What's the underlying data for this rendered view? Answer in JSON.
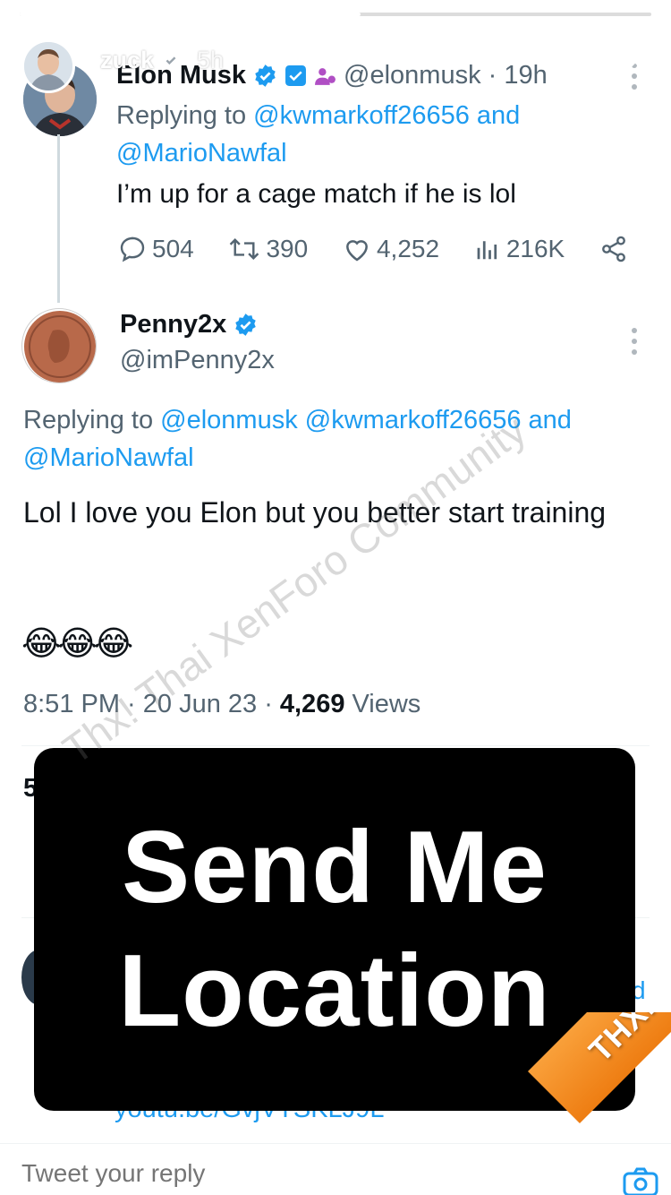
{
  "story": {
    "username": "zuck",
    "time": "5h",
    "progress": 0.54
  },
  "tweet1": {
    "name": "Elon Musk",
    "handle_time": "@elonmusk · 19h",
    "replying_prefix": "Replying to",
    "replying_handle1": "@kwmarkoff26656",
    "replying_and": "and",
    "replying_handle2": "@MarioNawfal",
    "text": "I’m up for a cage match if he is lol",
    "replies": "504",
    "retweets": "390",
    "likes": "4,252",
    "views": "216K"
  },
  "tweet2": {
    "name": "Penny2x",
    "handle": "@imPenny2x",
    "replying_prefix": "Replying to",
    "replying_handle1": "@elonmusk",
    "replying_handle2": "@kwmarkoff26656",
    "replying_and": "and",
    "replying_handle3": "@MarioNawfal",
    "text": "Lol I love you Elon but you better start training",
    "emoji": "😂😂😂",
    "time_date": "8:51 PM · 20 Jun 23 ·",
    "views_count": "4,269",
    "views_label": "Views"
  },
  "hidden_fragments": {
    "stat_digit": "5",
    "letter_d": "d",
    "link_partial": "youtu.be/GvjVTSKLJ9L"
  },
  "overlay": {
    "line1": "Send Me",
    "line2": "Location"
  },
  "watermark": "Thx! Thai XenForo Community",
  "badge": "THXF.ORG",
  "composer": {
    "placeholder": "Tweet your reply"
  },
  "colors": {
    "link": "#1d9bf0",
    "verified": "#1d9bf0",
    "secondary_text": "#536471",
    "badge_orange": "#f39325",
    "overlay_bg": "#000000"
  },
  "icons": [
    "close-icon",
    "verified-badge-icon",
    "more-options-icon",
    "reply-icon",
    "retweet-icon",
    "like-icon",
    "views-icon",
    "share-icon",
    "camera-icon"
  ]
}
